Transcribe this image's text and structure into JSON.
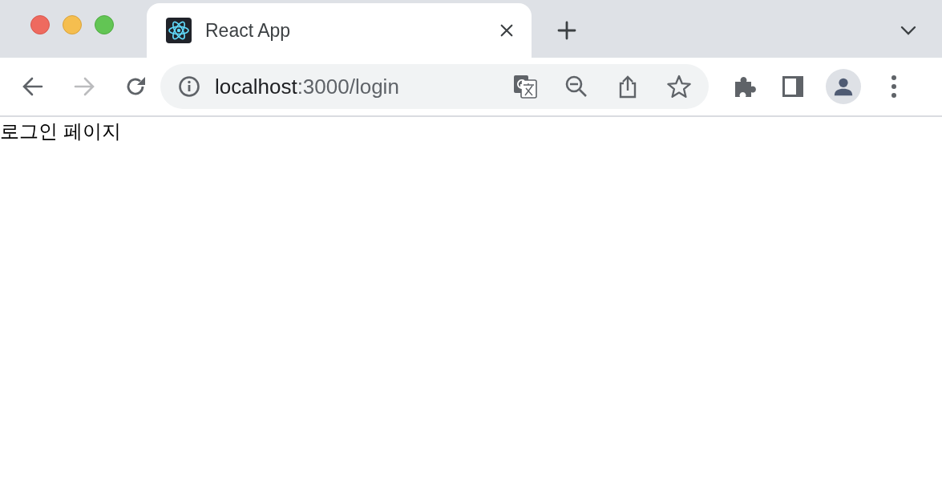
{
  "tabs": [
    {
      "title": "React App",
      "selected": true
    }
  ],
  "nav": {
    "back_disabled": false,
    "forward_disabled": true
  },
  "address": {
    "host": "localhost",
    "path": ":3000/login"
  },
  "page": {
    "text": "로그인 페이지"
  }
}
